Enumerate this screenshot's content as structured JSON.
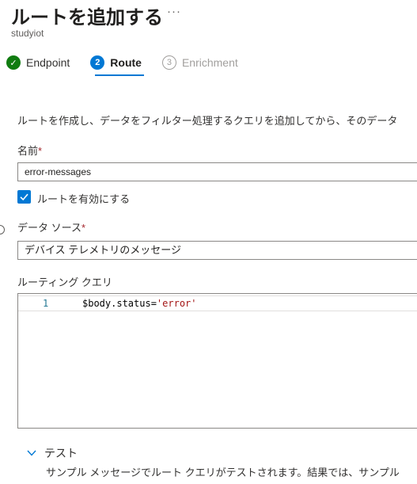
{
  "header": {
    "title": "ルートを追加する",
    "more_label": "···",
    "subtitle": "studyiot"
  },
  "steps": [
    {
      "number": "✓",
      "label": "Endpoint",
      "state": "done"
    },
    {
      "number": "2",
      "label": "Route",
      "state": "active"
    },
    {
      "number": "3",
      "label": "Enrichment",
      "state": "pending"
    }
  ],
  "form": {
    "description": "ルートを作成し、データをフィルター処理するクエリを追加してから、そのデータ",
    "name_label": "名前",
    "required_mark": "*",
    "name_value": "error-messages",
    "enable_label": "ルートを有効にする",
    "enable_checked": true,
    "source_label": "データ ソース",
    "source_value": "デバイス テレメトリのメッセージ",
    "query_label": "ルーティング クエリ",
    "query_line_number": "1",
    "query_code_prefix": "$body.status=",
    "query_code_string": "'error'"
  },
  "test": {
    "toggle_label": "テスト",
    "description": "サンプル メッセージでルート クエリがテストされます。結果では、サンプル"
  },
  "colors": {
    "accent": "#0078d4",
    "success": "#107c10",
    "required": "#a4262c"
  }
}
